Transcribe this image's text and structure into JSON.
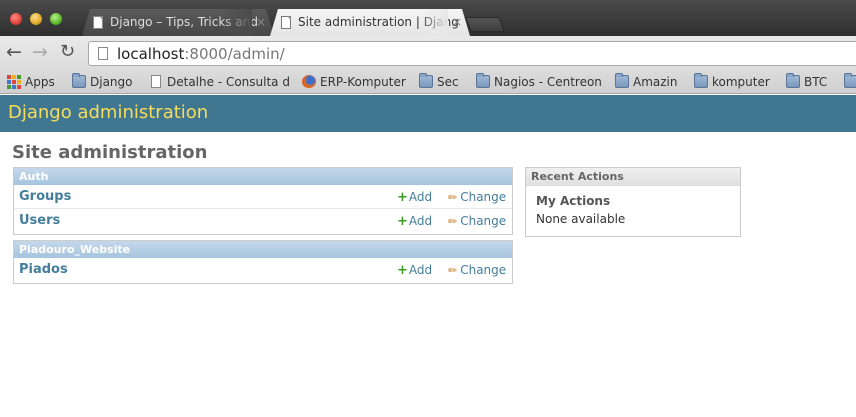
{
  "browser": {
    "tabs": [
      {
        "label": "Django – Tips, Tricks and"
      },
      {
        "label": "Site administration | Djang"
      }
    ],
    "close_glyph": "×",
    "url_host": "localhost",
    "url_rest": ":8000/admin/",
    "bookmarks": [
      {
        "label": "Apps",
        "icon": "apps-icon"
      },
      {
        "label": "Django",
        "icon": "folder-icon"
      },
      {
        "label": "Detalhe - Consulta d",
        "icon": "page-icon"
      },
      {
        "label": "ERP-Komputer",
        "icon": "firefox-icon"
      },
      {
        "label": "Sec",
        "icon": "folder-icon"
      },
      {
        "label": "Nagios - Centreon",
        "icon": "folder-icon"
      },
      {
        "label": "Amazin",
        "icon": "folder-icon"
      },
      {
        "label": "komputer",
        "icon": "folder-icon"
      },
      {
        "label": "BTC",
        "icon": "folder-icon"
      }
    ]
  },
  "admin": {
    "branding": "Django administration",
    "title": "Site administration",
    "modules": [
      {
        "caption": "Auth",
        "models": [
          {
            "name": "Groups",
            "add": "Add",
            "change": "Change"
          },
          {
            "name": "Users",
            "add": "Add",
            "change": "Change"
          }
        ]
      },
      {
        "caption": "Piadouro_Website",
        "models": [
          {
            "name": "Piados",
            "add": "Add",
            "change": "Change"
          }
        ]
      }
    ],
    "recent_actions": {
      "caption": "Recent Actions",
      "subtitle": "My Actions",
      "empty": "None available"
    }
  },
  "colors": {
    "header_bg": "#417690",
    "branding_text": "#f5dd5d",
    "link": "#447e9b",
    "module_caption": "#a6c4df"
  }
}
